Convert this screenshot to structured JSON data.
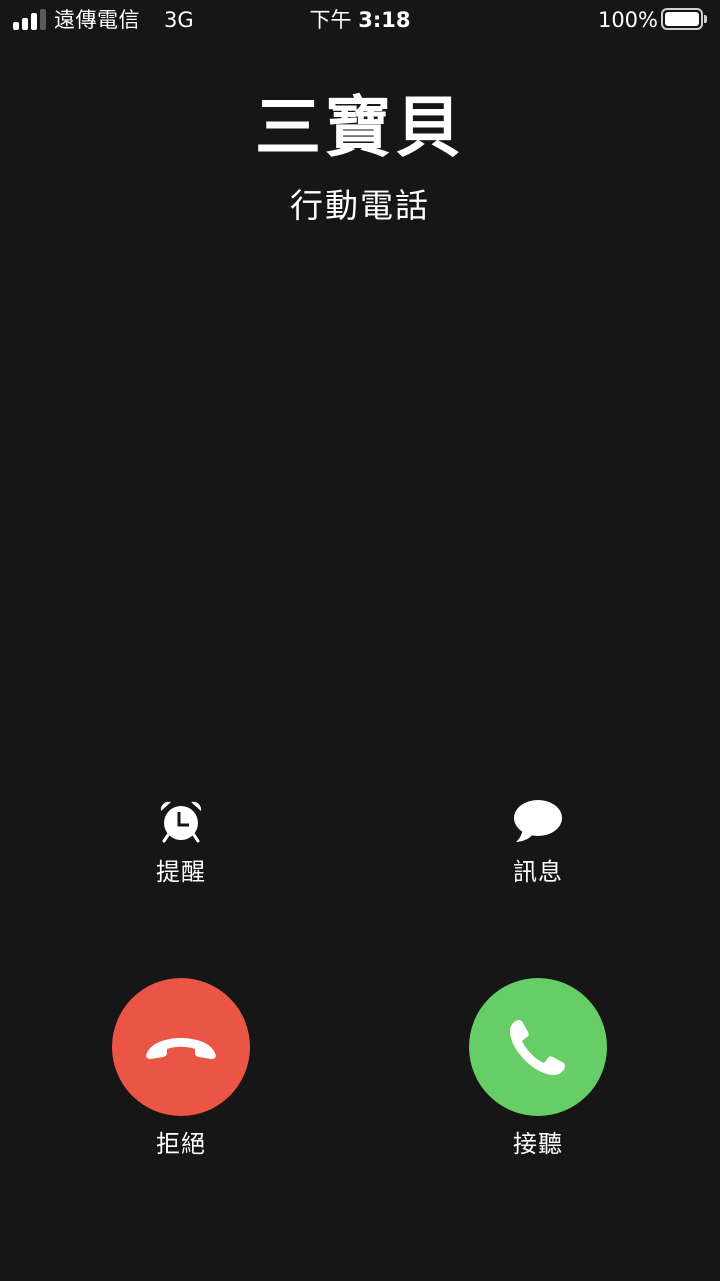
{
  "status_bar": {
    "carrier": "遠傳電信",
    "network": "3G",
    "time_prefix": "下午",
    "time": "3:18",
    "battery": "100%"
  },
  "caller": {
    "name": "三寶貝",
    "type": "行動電話"
  },
  "actions": {
    "remind": {
      "label": "提醒",
      "icon": "alarm-clock-icon"
    },
    "message": {
      "label": "訊息",
      "icon": "speech-bubble-icon"
    }
  },
  "call_buttons": {
    "decline": {
      "label": "拒絕",
      "icon": "hang-up-phone-icon",
      "color": "#EB5545"
    },
    "accept": {
      "label": "接聽",
      "icon": "phone-icon",
      "color": "#67CE67"
    }
  },
  "colors": {
    "background": "#161616",
    "text": "#FFFFFF"
  }
}
